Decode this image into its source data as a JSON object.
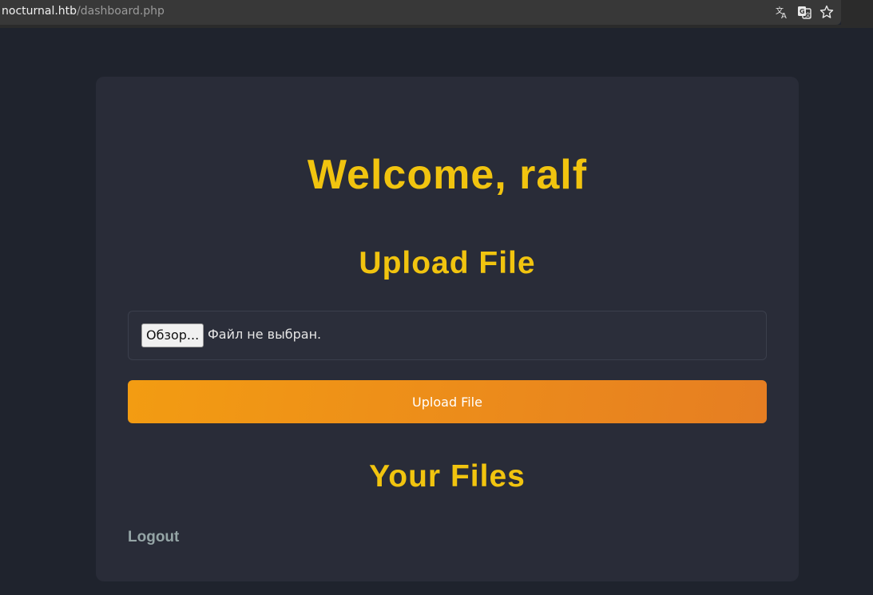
{
  "browser": {
    "url_host": "nocturnal.htb",
    "url_path": "/dashboard.php",
    "icons": [
      "translate-icon",
      "page-translate-icon",
      "bookmark-star-icon"
    ]
  },
  "page": {
    "welcome": "Welcome, ralf",
    "upload_heading": "Upload File",
    "file_input": {
      "browse_label": "Обзор...",
      "status": "Файл не выбран."
    },
    "upload_button": "Upload File",
    "files_heading": "Your Files",
    "logout": "Logout"
  },
  "colors": {
    "background": "#1f232d",
    "card": "#292c38",
    "heading": "#f1c40f",
    "button_gradient_start": "#f39c12",
    "button_gradient_end": "#e67e22",
    "logout": "#95a5a6"
  }
}
